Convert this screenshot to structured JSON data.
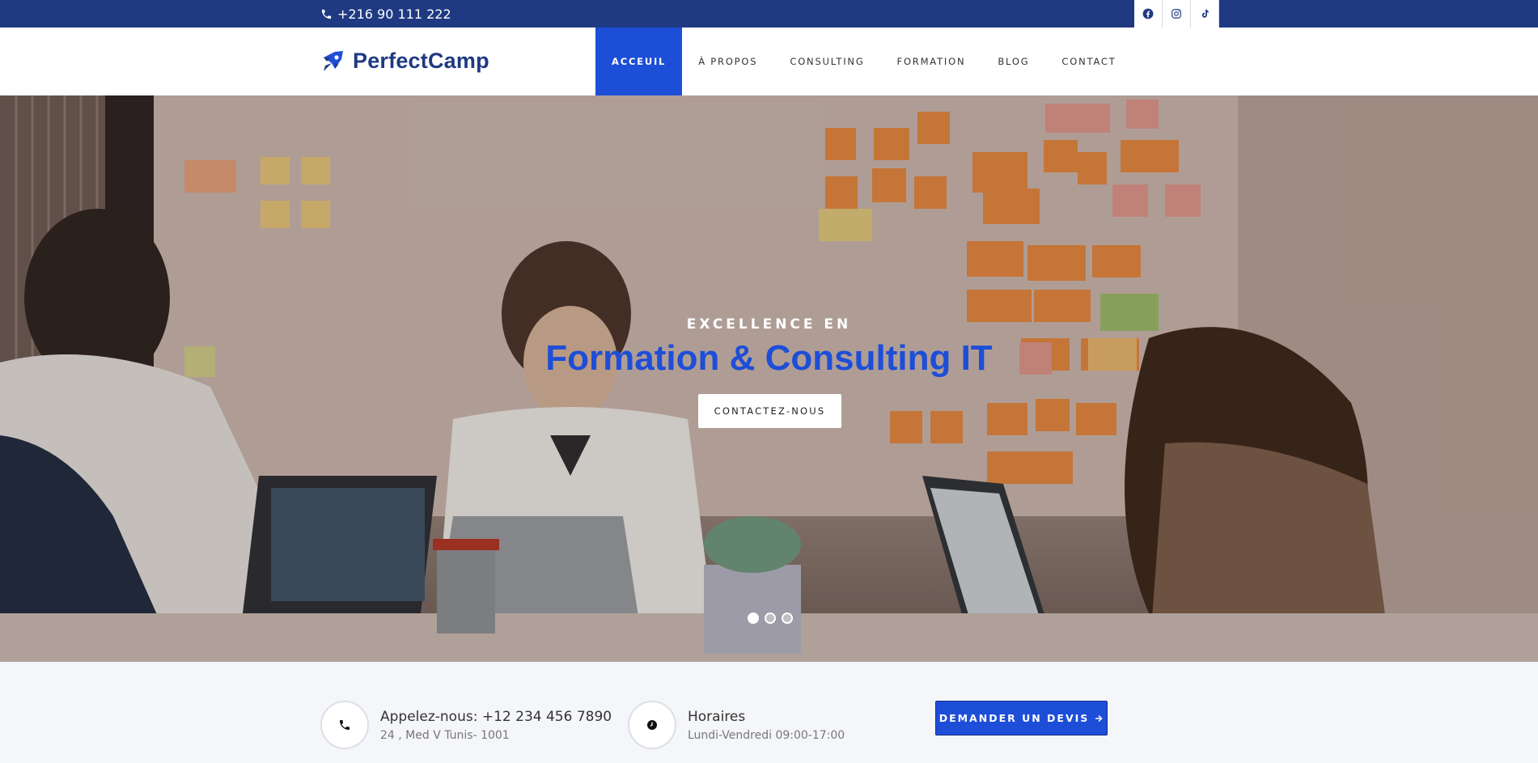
{
  "topbar": {
    "phone": "+216 90 111 222",
    "socials": [
      {
        "icon": "facebook-icon"
      },
      {
        "icon": "instagram-icon"
      },
      {
        "icon": "tiktok-icon"
      }
    ]
  },
  "brand": {
    "name": "PerfectCamp",
    "logo_icon": "rocket-logo-icon",
    "primary_color": "#1d4ed8",
    "dark_color": "#1f3a82"
  },
  "nav": {
    "items": [
      {
        "label": "ACCEUIL",
        "active": true
      },
      {
        "label": "À PROPOS",
        "active": false
      },
      {
        "label": "CONSULTING",
        "active": false
      },
      {
        "label": "FORMATION",
        "active": false
      },
      {
        "label": "BLOG",
        "active": false
      },
      {
        "label": "CONTACT",
        "active": false
      }
    ]
  },
  "hero": {
    "subtitle": "EXCELLENCE EN",
    "title": "Formation & Consulting IT",
    "cta_label": "CONTACTEZ-NOUS",
    "slides": 3,
    "active_slide": 1
  },
  "info": {
    "call_title": "Appelez-nous: +12 234 456 7890",
    "call_sub": "24 , Med V Tunis- 1001",
    "hours_title": "Horaires",
    "hours_sub": "Lundi-Vendredi 09:00-17:00",
    "devis_label": "DEMANDER UN DEVIS"
  }
}
